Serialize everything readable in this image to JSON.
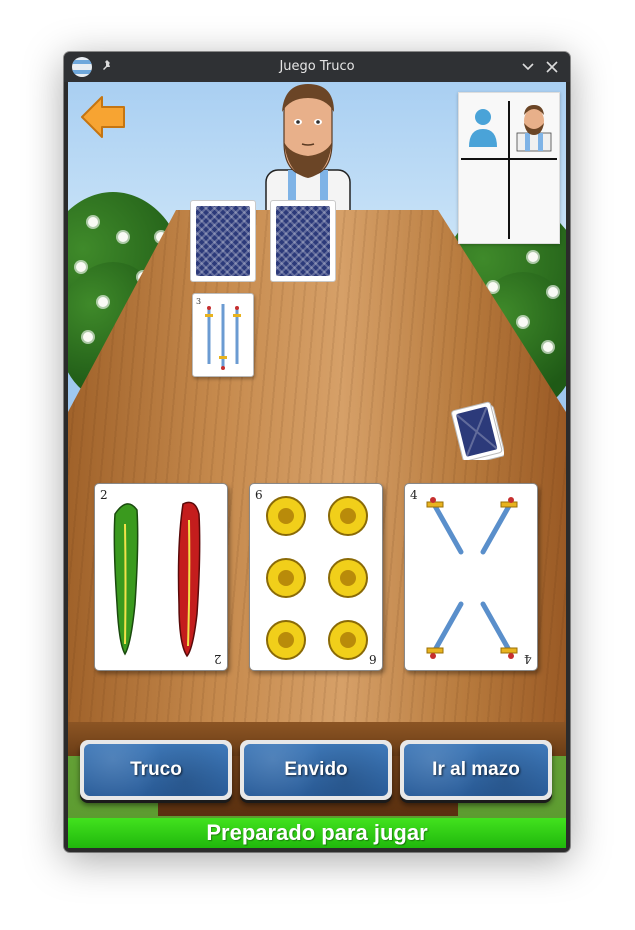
{
  "window": {
    "title": "Juego Truco"
  },
  "titlebar_icons": [
    "app-icon",
    "pin-icon",
    "minimize-chevron-icon",
    "close-icon"
  ],
  "game": {
    "opponent_cards_face_down": 2,
    "played_card": {
      "suit": "espadas",
      "number": "3"
    },
    "player_hand": [
      {
        "suit": "bastos",
        "number": "2"
      },
      {
        "suit": "oros",
        "number": "6"
      },
      {
        "suit": "espadas",
        "number": "4"
      }
    ]
  },
  "buttons": {
    "truco": "Truco",
    "envido": "Envido",
    "mazo": "Ir al mazo"
  },
  "status": {
    "text": "Preparado para jugar"
  },
  "colors": {
    "button_blue": "#2f66a8",
    "status_green": "#2ccc14",
    "card_back": "#2c3a7a",
    "back_arrow": "#f7a432"
  }
}
